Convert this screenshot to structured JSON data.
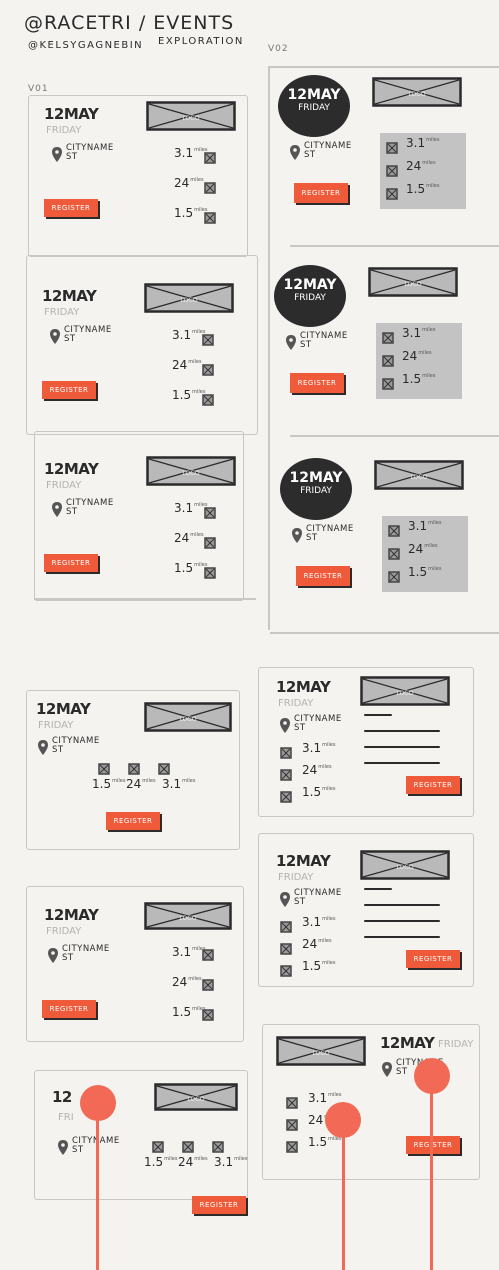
{
  "header": {
    "title": "@RACETRI / EVENTS",
    "handle": "@KELSYGAGNEBIN",
    "subtitle": "EXPLORATION"
  },
  "versions": {
    "v1": "V01",
    "v2": "V02"
  },
  "event": {
    "date": "12MAY",
    "day": "FRIDAY",
    "city": "CITYNAME",
    "state": "ST",
    "logo": "LOGO",
    "register": "REGISTER"
  },
  "distances": [
    {
      "value": "3.1",
      "unit": "miles"
    },
    {
      "value": "24",
      "unit": "miles"
    },
    {
      "value": "1.5",
      "unit": "miles"
    }
  ],
  "colors": {
    "accent": "#ef5a3a",
    "dark": "#2c2c2c",
    "gray": "#c3c3c3",
    "background": "#f4f3f0"
  }
}
